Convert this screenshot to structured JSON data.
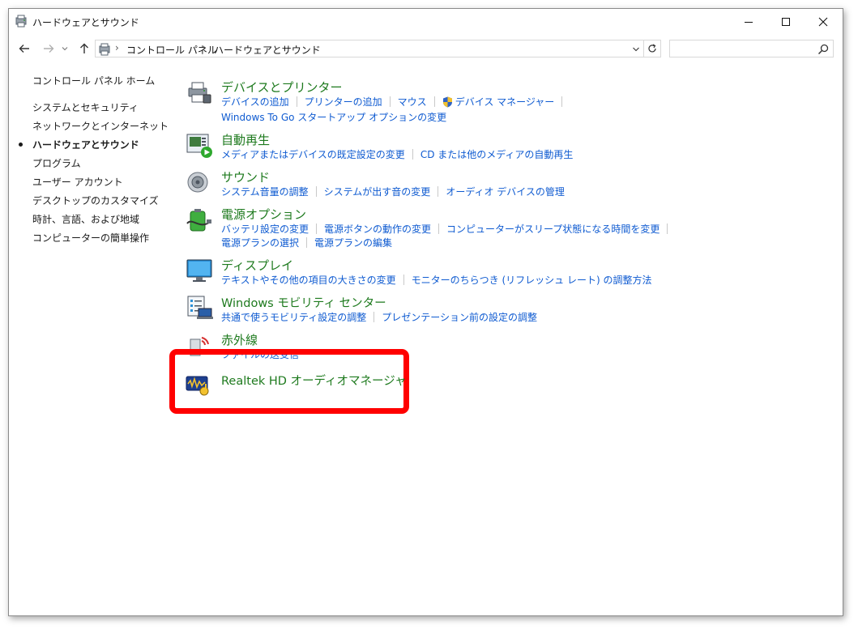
{
  "window": {
    "title": "ハードウェアとサウンド"
  },
  "addressbar": {
    "crumbs": [
      "コントロール パネル",
      "ハードウェアとサウンド"
    ],
    "search_placeholder": ""
  },
  "sidebar": {
    "home": "コントロール パネル ホーム",
    "items": [
      {
        "label": "システムとセキュリティ"
      },
      {
        "label": "ネットワークとインターネット"
      },
      {
        "label": "ハードウェアとサウンド",
        "current": true
      },
      {
        "label": "プログラム"
      },
      {
        "label": "ユーザー アカウント"
      },
      {
        "label": "デスクトップのカスタマイズ"
      },
      {
        "label": "時計、言語、および地域"
      },
      {
        "label": "コンピューターの簡単操作"
      }
    ]
  },
  "categories": [
    {
      "title": "デバイスとプリンター",
      "icon": "printer-icon",
      "lines": [
        [
          "デバイスの追加",
          "プリンターの追加",
          "マウス",
          "デバイス マネージャー"
        ],
        [
          "Windows To Go スタートアップ オプションの変更"
        ]
      ]
    },
    {
      "title": "自動再生",
      "icon": "autoplay-icon",
      "lines": [
        [
          "メディアまたはデバイスの既定設定の変更",
          "CD または他のメディアの自動再生"
        ]
      ]
    },
    {
      "title": "サウンド",
      "icon": "speaker-icon",
      "lines": [
        [
          "システム音量の調整",
          "システムが出す音の変更",
          "オーディオ デバイスの管理"
        ]
      ]
    },
    {
      "title": "電源オプション",
      "icon": "battery-icon",
      "lines": [
        [
          "バッテリ設定の変更",
          "電源ボタンの動作の変更",
          "コンピューターがスリープ状態になる時間を変更"
        ],
        [
          "電源プランの選択",
          "電源プランの編集"
        ]
      ]
    },
    {
      "title": "ディスプレイ",
      "icon": "monitor-icon",
      "lines": [
        [
          "テキストやその他の項目の大きさの変更",
          "モニターのちらつき (リフレッシュ レート) の調整方法"
        ]
      ]
    },
    {
      "title": "Windows モビリティ センター",
      "icon": "mobility-center-icon",
      "lines": [
        [
          "共通で使うモビリティ設定の調整",
          "プレゼンテーション前の設定の調整"
        ]
      ]
    },
    {
      "title": "赤外線",
      "icon": "infrared-icon",
      "lines": [
        [
          "ファイルの送受信"
        ]
      ]
    },
    {
      "title": "Realtek HD オーディオマネージャ",
      "icon": "realtek-audio-icon",
      "lines": []
    }
  ],
  "colors": {
    "category_title": "#1e7a1e",
    "link": "#0f5bd1",
    "highlight": "#ff0000"
  }
}
